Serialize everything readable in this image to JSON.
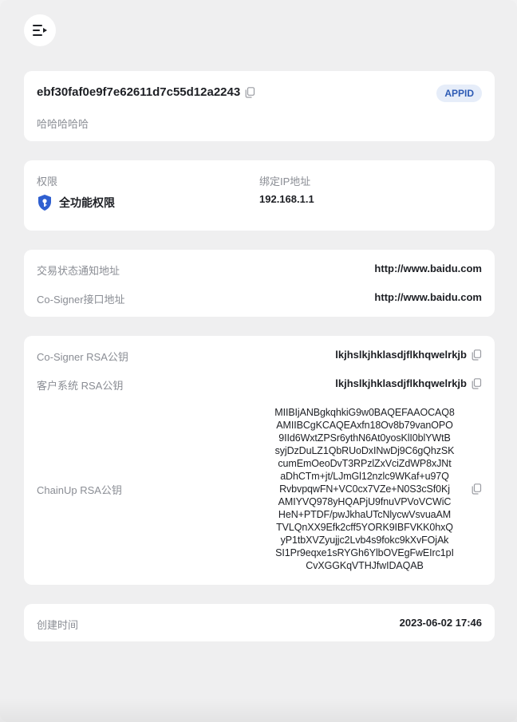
{
  "header": {
    "menu_icon": "menu-collapse-icon"
  },
  "app": {
    "appid": "ebf30faf0e9f7e62611d7c55d12a2243",
    "badge": "APPID",
    "name": "哈哈哈哈哈"
  },
  "permission": {
    "label": "权限",
    "value": "全功能权限",
    "ip_label": "绑定IP地址",
    "ip_value": "192.168.1.1"
  },
  "urls": {
    "notify_label": "交易状态通知地址",
    "notify_value": "http://www.baidu.com",
    "cosigner_label": "Co-Signer接口地址",
    "cosigner_value": "http://www.baidu.com"
  },
  "rsa": {
    "cosigner_label": "Co-Signer RSA公钥",
    "cosigner_value": "lkjhslkjhklasdjflkhqwelrkjb",
    "client_label": "客户系统 RSA公钥",
    "client_value": "lkjhslkjhklasdjflkhqwelrkjb",
    "chainup_label": "ChainUp RSA公钥",
    "chainup_value": "MIIBIjANBgkqhkiG9w0BAQEFAAOCAQ8\nAMIIBCgKCAQEAxfn18Ov8b79vanOPO\n9IId6WxtZPSr6ythN6At0yosKlI0blYWtB\nsyjDzDuLZ1QbRUoDxINwDj9C6gQhzSK\ncumEmOeoDvT3RPzlZxVciZdWP8xJNt\naDhCTm+jt/LJmGl12nzlc9WKaf+u97Q\nRvbvpqwFN+VC0cx7VZe+N0S3cSf0Kj\nAMIYVQ978yHQAPjU9fnuVPVoVCWiC\nHeN+PTDF/pwJkhaUTcNlycwVsvuaAM\nTVLQnXX9Efk2cff5YORK9IBFVKK0hxQ\nyP1tbXVZyujjc2Lvb4s9fokc9kXvFOjAk\nSI1Pr9eqxe1sRYGh6YlbOVEgFwEIrc1pI\nCvXGGKqVTHJfwIDAQAB"
  },
  "created": {
    "label": "创建时间",
    "value": "2023-06-02 17:46"
  },
  "colors": {
    "accent": "#2d5bb5",
    "badge_bg": "#e6edf9",
    "shield": "#2f5fd0"
  }
}
